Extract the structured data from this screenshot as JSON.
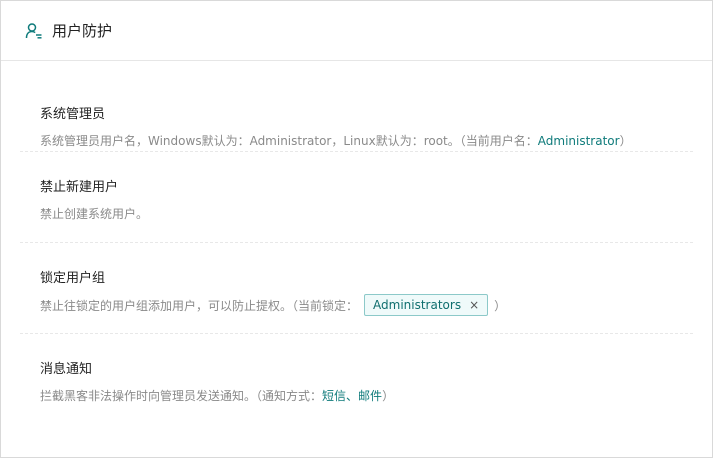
{
  "header": {
    "title": "用户防护",
    "icon": "user-shield-icon"
  },
  "sections": [
    {
      "title": "系统管理员",
      "desc_prefix": "系统管理员用户名，Windows默认为：Administrator，Linux默认为：root。（当前用户名：",
      "current_user": "Administrator",
      "desc_suffix": "）"
    },
    {
      "title": "禁止新建用户",
      "desc": "禁止创建系统用户。"
    },
    {
      "title": "锁定用户组",
      "desc_prefix": "禁止往锁定的用户组添加用户，可以防止提权。（当前锁定：",
      "tag": "Administrators",
      "tag_close": "×",
      "desc_suffix": "）"
    },
    {
      "title": "消息通知",
      "desc_prefix": "拦截黑客非法操作时向管理员发送通知。（通知方式：",
      "method_sms": "短信",
      "separator": "、",
      "method_email": "邮件",
      "desc_suffix": "）"
    }
  ],
  "colors": {
    "accent": "#0f7b7b",
    "muted": "#8a8a8a",
    "tag_border": "#8cc9c9",
    "tag_bg": "#effafa"
  }
}
